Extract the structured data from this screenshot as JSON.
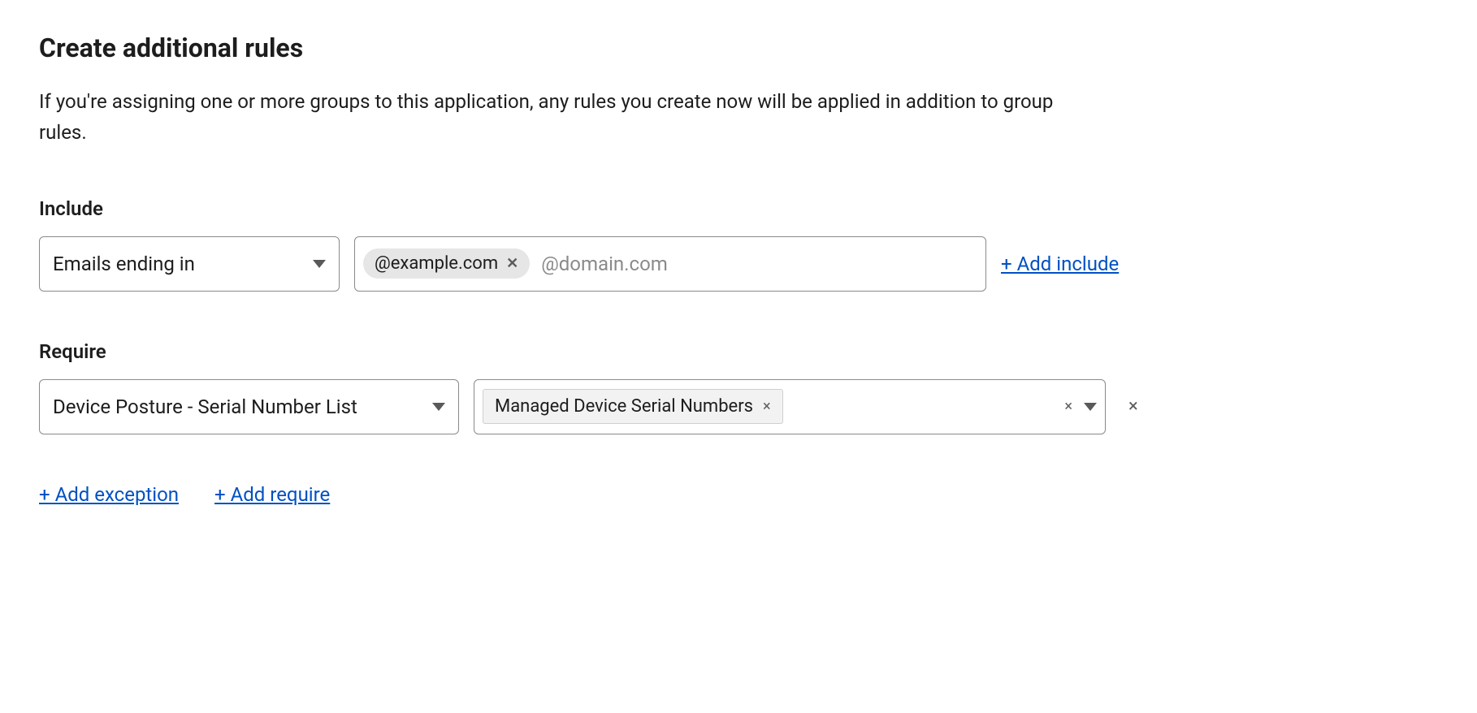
{
  "header": {
    "title": "Create additional rules",
    "description": "If you're assigning one or more groups to this application, any rules you create now will be applied in addition to group rules."
  },
  "include": {
    "label": "Include",
    "selector_value": "Emails ending in",
    "chips": [
      {
        "text": "@example.com"
      }
    ],
    "placeholder": "@domain.com",
    "add_link": "+ Add include"
  },
  "require": {
    "label": "Require",
    "selector_value": "Device Posture - Serial Number List",
    "chips": [
      {
        "text": "Managed Device Serial Numbers"
      }
    ]
  },
  "footer": {
    "add_exception": "+ Add exception",
    "add_require": "+ Add require"
  }
}
